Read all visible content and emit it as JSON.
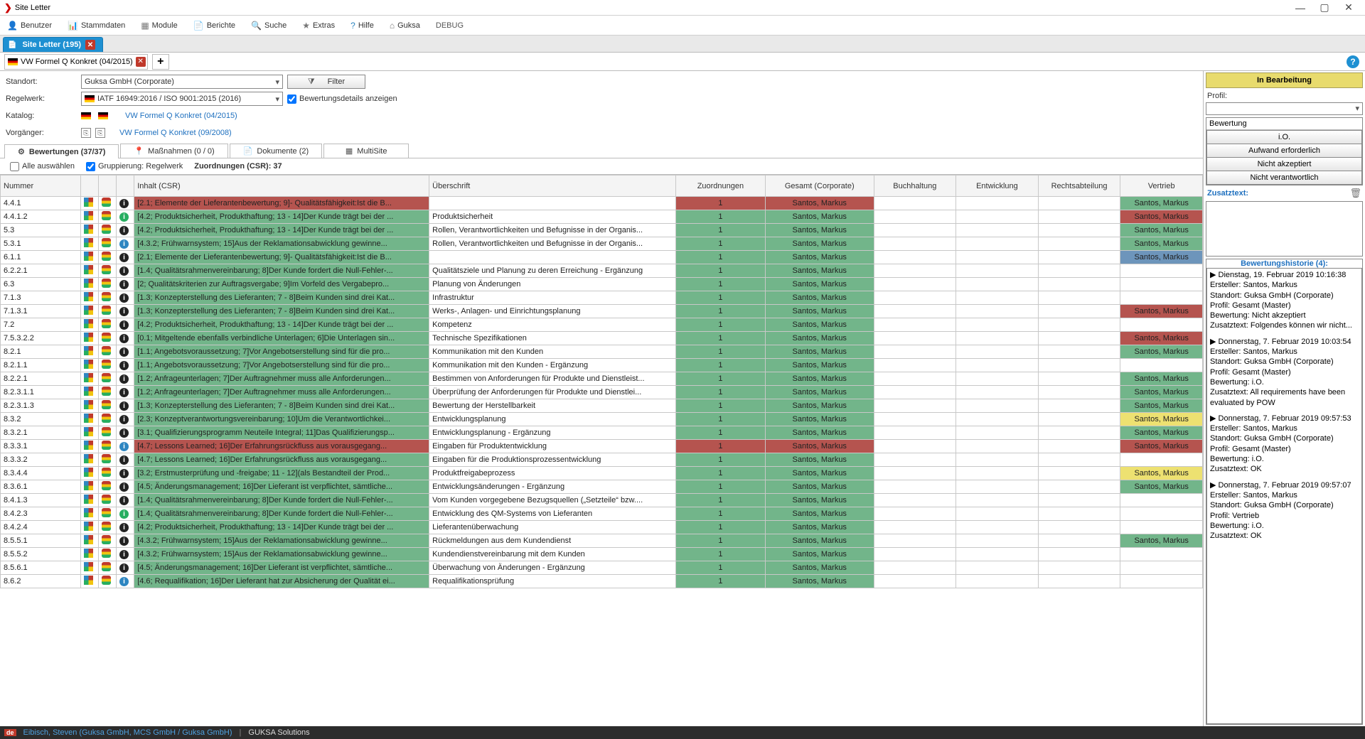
{
  "window": {
    "title": "Site Letter"
  },
  "menu": [
    {
      "icon": "👤",
      "iconClass": "icon-red",
      "label": "Benutzer"
    },
    {
      "icon": "📊",
      "iconClass": "icon-grey",
      "label": "Stammdaten"
    },
    {
      "icon": "▦",
      "iconClass": "icon-grey",
      "label": "Module"
    },
    {
      "icon": "📄",
      "iconClass": "icon-grey",
      "label": "Berichte"
    },
    {
      "icon": "🔍",
      "iconClass": "icon-grey",
      "label": "Suche"
    },
    {
      "icon": "★",
      "iconClass": "icon-grey",
      "label": "Extras"
    },
    {
      "icon": "?",
      "iconClass": "icon-blue",
      "label": "Hilfe"
    },
    {
      "icon": "⌂",
      "iconClass": "icon-grey",
      "label": "Guksa"
    },
    {
      "icon": "",
      "iconClass": "",
      "label": "DEBUG"
    }
  ],
  "docTab": {
    "label": "Site Letter (195)"
  },
  "innerTab": {
    "label": "VW Formel Q Konkret (04/2015)"
  },
  "form": {
    "standort_label": "Standort:",
    "standort_value": "Guksa GmbH (Corporate)",
    "regelwerk_label": "Regelwerk:",
    "regelwerk_value": "IATF 16949:2016 / ISO 9001:2015 (2016)",
    "katalog_label": "Katalog:",
    "katalog_link": "VW Formel Q Konkret (04/2015)",
    "vorgaenger_label": "Vorgänger:",
    "vorgaenger_link": "VW Formel Q Konkret (09/2008)",
    "filter_label": "Filter",
    "details_label": "Bewertungsdetails anzeigen"
  },
  "midTabs": {
    "bewertungen": "Bewertungen (37/37)",
    "massnahmen": "Maßnahmen (0 / 0)",
    "dokumente": "Dokumente (2)",
    "multisite": "MultiSite"
  },
  "groupRow": {
    "alle": "Alle auswählen",
    "grouping": "Gruppierung: Regelwerk",
    "zuord": "Zuordnungen (CSR): 37"
  },
  "columns": {
    "nummer": "Nummer",
    "inhalt": "Inhalt (CSR)",
    "ueberschrift": "Überschrift",
    "zuordnungen": "Zuordnungen",
    "gesamt": "Gesamt (Corporate)",
    "buchhaltung": "Buchhaltung",
    "entwicklung": "Entwicklung",
    "rechtsabteilung": "Rechtsabteilung",
    "vertrieb": "Vertrieb"
  },
  "rows": [
    {
      "num": "4.4.1",
      "info": "b",
      "inhalt": "[2.1; Elemente der Lieferantenbewertung; 9]- Qualitätsfähigkeit:Ist die B...",
      "inhaltCls": "red-cell",
      "ub": "",
      "gesCls": "red-cell",
      "ges": "Santos, Markus",
      "ver": "Santos, Markus",
      "verCls": "green-cell"
    },
    {
      "num": "4.4.1.2",
      "info": "g",
      "inhalt": "[4.2; Produktsicherheit, Produkthaftung; 13 - 14]Der Kunde trägt bei der ...",
      "inhaltCls": "green-cell",
      "ub": "Produktsicherheit",
      "gesCls": "green-cell",
      "ges": "Santos, Markus",
      "ver": "Santos, Markus",
      "verCls": "red-cell"
    },
    {
      "num": "5.3",
      "info": "b",
      "inhalt": "[4.2; Produktsicherheit, Produkthaftung; 13 - 14]Der Kunde trägt bei der ...",
      "inhaltCls": "green-cell",
      "ub": "Rollen, Verantwortlichkeiten und Befugnisse in der Organis...",
      "gesCls": "green-cell",
      "ges": "Santos, Markus",
      "ver": "Santos, Markus",
      "verCls": "green-cell"
    },
    {
      "num": "5.3.1",
      "info": "i",
      "inhalt": "[4.3.2; Frühwarnsystem; 15]Aus der Reklamationsabwicklung gewinne...",
      "inhaltCls": "green-cell",
      "ub": "Rollen, Verantwortlichkeiten und Befugnisse in der Organis...",
      "gesCls": "green-cell",
      "ges": "Santos, Markus",
      "ver": "Santos, Markus",
      "verCls": "green-cell"
    },
    {
      "num": "6.1.1",
      "info": "b",
      "inhalt": "[2.1; Elemente der Lieferantenbewertung; 9]- Qualitätsfähigkeit:Ist die B...",
      "inhaltCls": "green-cell",
      "ub": "",
      "gesCls": "green-cell",
      "ges": "Santos, Markus",
      "ver": "Santos, Markus",
      "verCls": "blue-cell"
    },
    {
      "num": "6.2.2.1",
      "info": "b",
      "inhalt": "[1.4; Qualitätsrahmenvereinbarung; 8]Der Kunde fordert die Null-Fehler-...",
      "inhaltCls": "green-cell",
      "ub": "Qualitätsziele und Planung zu deren Erreichung - Ergänzung",
      "gesCls": "green-cell",
      "ges": "Santos, Markus",
      "ver": "",
      "verCls": ""
    },
    {
      "num": "6.3",
      "info": "b",
      "inhalt": "[2; Qualitätskriterien zur Auftragsvergabe; 9]Im Vorfeld des Vergabepro...",
      "inhaltCls": "green-cell",
      "ub": "Planung von Änderungen",
      "gesCls": "green-cell",
      "ges": "Santos, Markus",
      "ver": "",
      "verCls": ""
    },
    {
      "num": "7.1.3",
      "info": "b",
      "inhalt": "[1.3; Konzepterstellung des Lieferanten; 7 - 8]Beim Kunden sind drei Kat...",
      "inhaltCls": "green-cell",
      "ub": "Infrastruktur",
      "gesCls": "green-cell",
      "ges": "Santos, Markus",
      "ver": "",
      "verCls": ""
    },
    {
      "num": "7.1.3.1",
      "info": "b",
      "inhalt": "[1.3; Konzepterstellung des Lieferanten; 7 - 8]Beim Kunden sind drei Kat...",
      "inhaltCls": "green-cell",
      "ub": "Werks-, Anlagen- und Einrichtungsplanung",
      "gesCls": "green-cell",
      "ges": "Santos, Markus",
      "ver": "Santos, Markus",
      "verCls": "red-cell"
    },
    {
      "num": "7.2",
      "info": "b",
      "inhalt": "[4.2; Produktsicherheit, Produkthaftung; 13 - 14]Der Kunde trägt bei der ...",
      "inhaltCls": "green-cell",
      "ub": "Kompetenz",
      "gesCls": "green-cell",
      "ges": "Santos, Markus",
      "ver": "",
      "verCls": ""
    },
    {
      "num": "7.5.3.2.2",
      "info": "b",
      "inhalt": "[0.1; Mitgeltende ebenfalls verbindliche Unterlagen; 6]Die Unterlagen sin...",
      "inhaltCls": "green-cell",
      "ub": "Technische Spezifikationen",
      "gesCls": "green-cell",
      "ges": "Santos, Markus",
      "ver": "Santos, Markus",
      "verCls": "red-cell"
    },
    {
      "num": "8.2.1",
      "info": "b",
      "inhalt": "[1.1; Angebotsvoraussetzung; 7]Vor Angebotserstellung sind für die pro...",
      "inhaltCls": "green-cell",
      "ub": "Kommunikation mit den Kunden",
      "gesCls": "green-cell",
      "ges": "Santos, Markus",
      "ver": "Santos, Markus",
      "verCls": "green-cell"
    },
    {
      "num": "8.2.1.1",
      "info": "b",
      "inhalt": "[1.1; Angebotsvoraussetzung; 7]Vor Angebotserstellung sind für die pro...",
      "inhaltCls": "green-cell",
      "ub": "Kommunikation mit den Kunden - Ergänzung",
      "gesCls": "green-cell",
      "ges": "Santos, Markus",
      "ver": "",
      "verCls": ""
    },
    {
      "num": "8.2.2.1",
      "info": "b",
      "inhalt": "[1.2; Anfrageunterlagen; 7]Der Auftragnehmer muss alle Anforderungen...",
      "inhaltCls": "green-cell",
      "ub": "Bestimmen von Anforderungen für Produkte und Dienstleist...",
      "gesCls": "green-cell",
      "ges": "Santos, Markus",
      "ver": "Santos, Markus",
      "verCls": "green-cell"
    },
    {
      "num": "8.2.3.1.1",
      "info": "b",
      "inhalt": "[1.2; Anfrageunterlagen; 7]Der Auftragnehmer muss alle Anforderungen...",
      "inhaltCls": "green-cell",
      "ub": "Überprüfung der Anforderungen für Produkte und Dienstlei...",
      "gesCls": "green-cell",
      "ges": "Santos, Markus",
      "ver": "Santos, Markus",
      "verCls": "green-cell"
    },
    {
      "num": "8.2.3.1.3",
      "info": "b",
      "inhalt": "[1.3; Konzepterstellung des Lieferanten; 7 - 8]Beim Kunden sind drei Kat...",
      "inhaltCls": "green-cell",
      "ub": "Bewertung der Herstellbarkeit",
      "gesCls": "green-cell",
      "ges": "Santos, Markus",
      "ver": "Santos, Markus",
      "verCls": "green-cell"
    },
    {
      "num": "8.3.2",
      "info": "b",
      "inhalt": "[2.3; Konzeptverantwortungsvereinbarung; 10]Um die Verantwortlichkei...",
      "inhaltCls": "green-cell",
      "ub": "Entwicklungsplanung",
      "gesCls": "green-cell",
      "ges": "Santos, Markus",
      "ver": "Santos, Markus",
      "verCls": "yellow-cell"
    },
    {
      "num": "8.3.2.1",
      "info": "b",
      "inhalt": "[3.1; Qualifizierungsprogramm Neuteile Integral; 11]Das Qualifizierungsp...",
      "inhaltCls": "green-cell",
      "ub": "Entwicklungsplanung - Ergänzung",
      "gesCls": "green-cell",
      "ges": "Santos, Markus",
      "ver": "Santos, Markus",
      "verCls": "green-cell"
    },
    {
      "num": "8.3.3.1",
      "info": "i",
      "inhalt": "[4.7; Lessons Learned; 16]Der Erfahrungsrückfluss aus vorausgegang...",
      "inhaltCls": "red-cell",
      "ub": "Eingaben für Produktentwicklung",
      "gesCls": "red-cell",
      "ges": "Santos, Markus",
      "ver": "Santos, Markus",
      "verCls": "red-cell"
    },
    {
      "num": "8.3.3.2",
      "info": "b",
      "inhalt": "[4.7; Lessons Learned; 16]Der Erfahrungsrückfluss aus vorausgegang...",
      "inhaltCls": "green-cell",
      "ub": "Eingaben für die Produktionsprozessentwicklung",
      "gesCls": "green-cell",
      "ges": "Santos, Markus",
      "ver": "",
      "verCls": ""
    },
    {
      "num": "8.3.4.4",
      "info": "b",
      "inhalt": "[3.2; Erstmusterprüfung und -freigabe; 11 - 12](als Bestandteil der Prod...",
      "inhaltCls": "green-cell",
      "ub": "Produktfreigabeprozess",
      "gesCls": "green-cell",
      "ges": "Santos, Markus",
      "ver": "Santos, Markus",
      "verCls": "yellow-cell"
    },
    {
      "num": "8.3.6.1",
      "info": "b",
      "inhalt": "[4.5; Änderungsmanagement; 16]Der Lieferant ist verpflichtet, sämtliche...",
      "inhaltCls": "green-cell",
      "ub": "Entwicklungsänderungen - Ergänzung",
      "gesCls": "green-cell",
      "ges": "Santos, Markus",
      "ver": "Santos, Markus",
      "verCls": "green-cell"
    },
    {
      "num": "8.4.1.3",
      "info": "b",
      "inhalt": "[1.4; Qualitätsrahmenvereinbarung; 8]Der Kunde fordert die Null-Fehler-...",
      "inhaltCls": "green-cell",
      "ub": "Vom Kunden vorgegebene Bezugsquellen („Setzteile“ bzw....",
      "gesCls": "green-cell",
      "ges": "Santos, Markus",
      "ver": "",
      "verCls": ""
    },
    {
      "num": "8.4.2.3",
      "info": "g",
      "inhalt": "[1.4; Qualitätsrahmenvereinbarung; 8]Der Kunde fordert die Null-Fehler-...",
      "inhaltCls": "green-cell",
      "ub": "Entwicklung des QM-Systems von Lieferanten",
      "gesCls": "green-cell",
      "ges": "Santos, Markus",
      "ver": "",
      "verCls": ""
    },
    {
      "num": "8.4.2.4",
      "info": "b",
      "inhalt": "[4.2; Produktsicherheit, Produkthaftung; 13 - 14]Der Kunde trägt bei der ...",
      "inhaltCls": "green-cell",
      "ub": "Lieferantenüberwachung",
      "gesCls": "green-cell",
      "ges": "Santos, Markus",
      "ver": "",
      "verCls": ""
    },
    {
      "num": "8.5.5.1",
      "info": "b",
      "inhalt": "[4.3.2; Frühwarnsystem; 15]Aus der Reklamationsabwicklung gewinne...",
      "inhaltCls": "green-cell",
      "ub": "Rückmeldungen aus dem Kundendienst",
      "gesCls": "green-cell",
      "ges": "Santos, Markus",
      "ver": "Santos, Markus",
      "verCls": "green-cell"
    },
    {
      "num": "8.5.5.2",
      "info": "b",
      "inhalt": "[4.3.2; Frühwarnsystem; 15]Aus der Reklamationsabwicklung gewinne...",
      "inhaltCls": "green-cell",
      "ub": "Kundendienstvereinbarung mit dem Kunden",
      "gesCls": "green-cell",
      "ges": "Santos, Markus",
      "ver": "",
      "verCls": ""
    },
    {
      "num": "8.5.6.1",
      "info": "b",
      "inhalt": "[4.5; Änderungsmanagement; 16]Der Lieferant ist verpflichtet, sämtliche...",
      "inhaltCls": "green-cell",
      "ub": "Überwachung von Änderungen - Ergänzung",
      "gesCls": "green-cell",
      "ges": "Santos, Markus",
      "ver": "",
      "verCls": ""
    },
    {
      "num": "8.6.2",
      "info": "i",
      "inhalt": "[4.6; Requalifikation; 16]Der Lieferant hat zur Absicherung der Qualität ei...",
      "inhaltCls": "green-cell",
      "ub": "Requalifikationsprüfung",
      "gesCls": "green-cell",
      "ges": "Santos, Markus",
      "ver": "",
      "verCls": ""
    }
  ],
  "rightPanel": {
    "status": "In Bearbeitung",
    "profil_label": "Profil:",
    "bewertung_title": "Bewertung",
    "btns": [
      "i.O.",
      "Aufwand erforderlich",
      "Nicht akzeptiert",
      "Nicht verantwortlich"
    ],
    "zusatz_label": "Zusatztext:",
    "hist_title": "Bewertungshistorie (4):",
    "history": [
      {
        "l1": "▶ Dienstag, 19. Februar 2019 10:16:38",
        "l2": "Ersteller: Santos, Markus",
        "l3": "Standort: Guksa GmbH (Corporate)",
        "l4": "Profil: Gesamt (Master)",
        "l5": "Bewertung: Nicht akzeptiert",
        "l6": "Zusatztext: Folgendes können wir nicht..."
      },
      {
        "l1": "▶ Donnerstag, 7. Februar 2019 10:03:54",
        "l2": "Ersteller: Santos, Markus",
        "l3": "Standort: Guksa GmbH (Corporate)",
        "l4": "Profil: Gesamt (Master)",
        "l5": "Bewertung: i.O.",
        "l6": "Zusatztext: All requirements have been evaluated by POW"
      },
      {
        "l1": "▶ Donnerstag, 7. Februar 2019 09:57:53",
        "l2": "Ersteller: Santos, Markus",
        "l3": "Standort: Guksa GmbH (Corporate)",
        "l4": "Profil: Gesamt (Master)",
        "l5": "Bewertung: i.O.",
        "l6": "Zusatztext: OK"
      },
      {
        "l1": "▶ Donnerstag, 7. Februar 2019 09:57:07",
        "l2": "Ersteller: Santos, Markus",
        "l3": "Standort: Guksa GmbH (Corporate)",
        "l4": "Profil: Vertrieb",
        "l5": "Bewertung: i.O.",
        "l6": "Zusatztext: OK"
      }
    ]
  },
  "status": {
    "user": "Eibisch, Steven (Guksa GmbH, MCS GmbH / Guksa GmbH)",
    "company": "GUKSA Solutions"
  }
}
